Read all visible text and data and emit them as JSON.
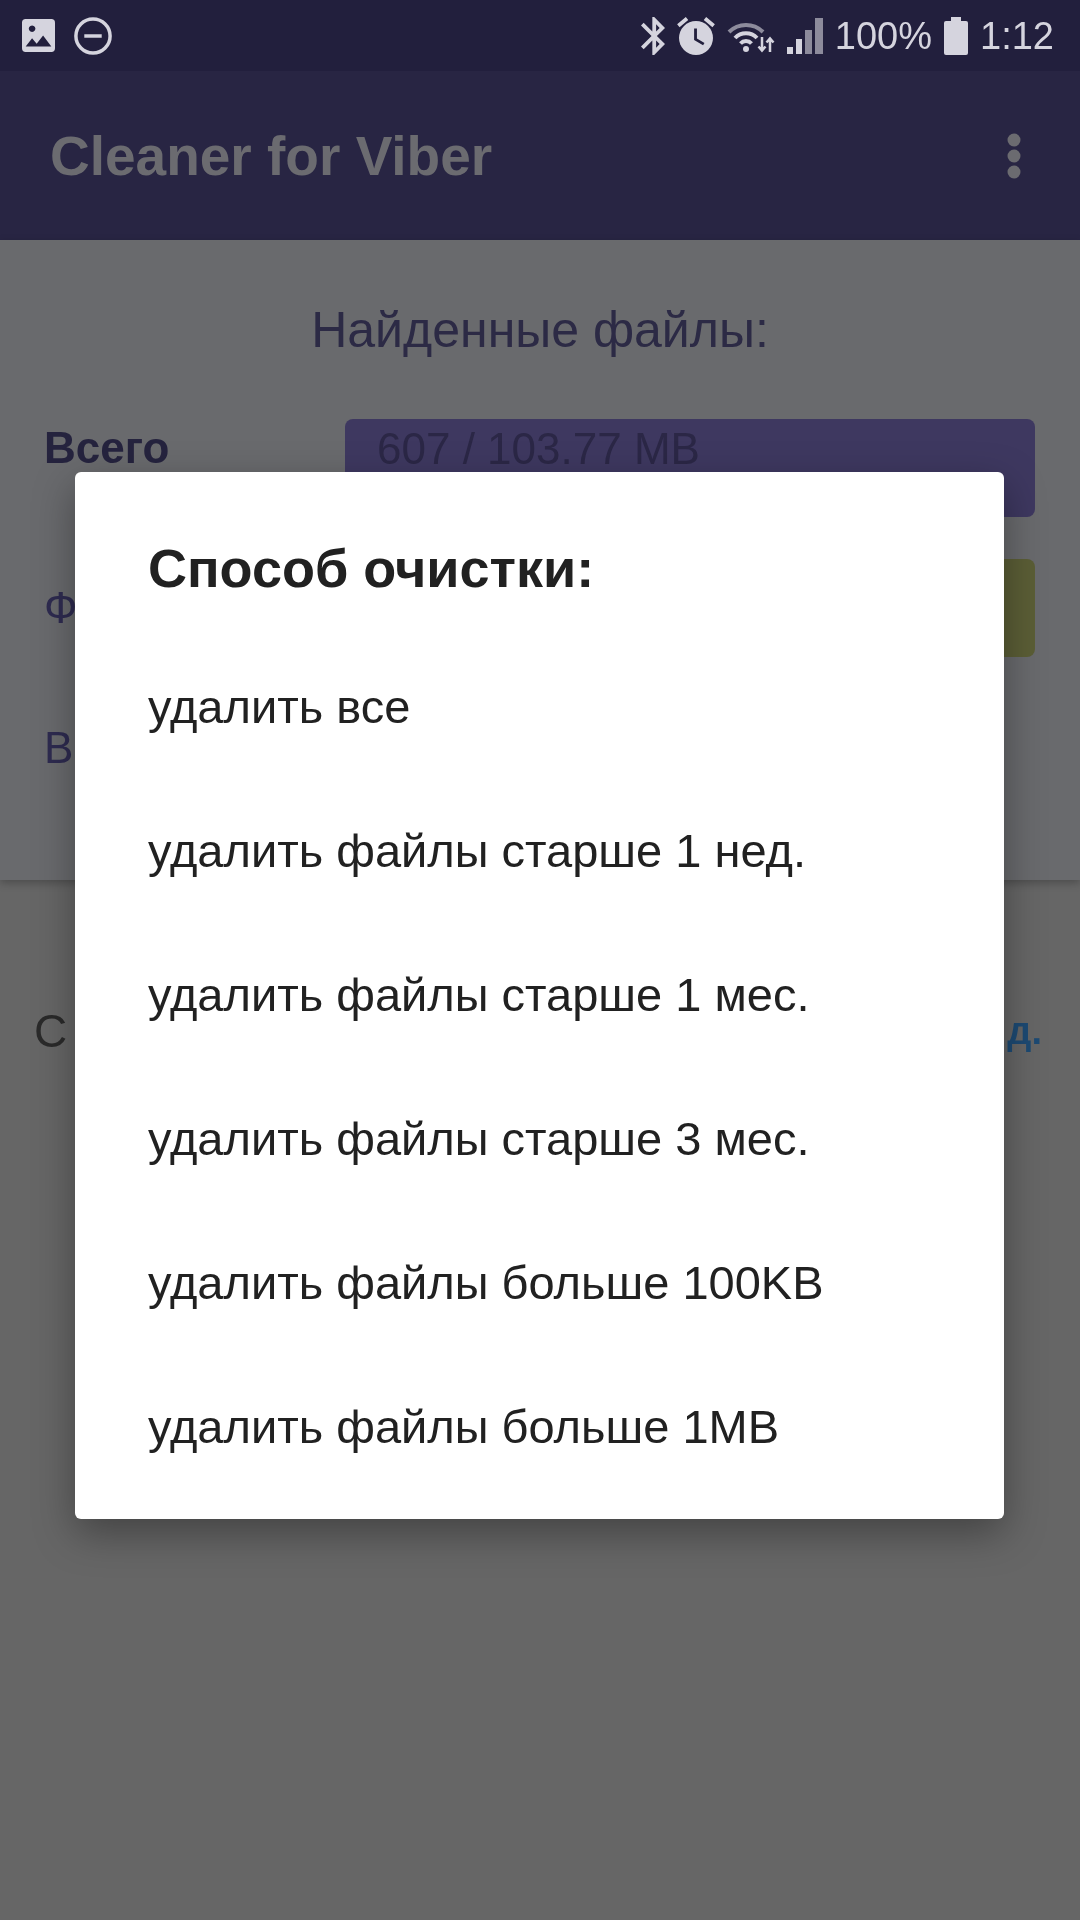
{
  "status_bar": {
    "battery": "100%",
    "time": "1:12"
  },
  "app_bar": {
    "title": "Cleaner for Viber"
  },
  "content": {
    "heading": "Найденные файлы:",
    "rows": [
      {
        "kind": "total",
        "label": "Всего",
        "value": "607 / 103.77 MB",
        "color": "#3e3860"
      },
      {
        "kind": "category",
        "label": "Ф",
        "color": "#5b5e36"
      },
      {
        "kind": "category",
        "label": "В"
      }
    ]
  },
  "footer": {
    "text": "С",
    "link": "д."
  },
  "dialog": {
    "title": "Способ очистки:",
    "options": [
      "удалить все",
      "удалить файлы старше 1 нед.",
      "удалить файлы старше 1 мес.",
      "удалить файлы старше 3 мес.",
      "удалить файлы больше 100KB",
      "удалить файлы больше 1MB"
    ]
  }
}
